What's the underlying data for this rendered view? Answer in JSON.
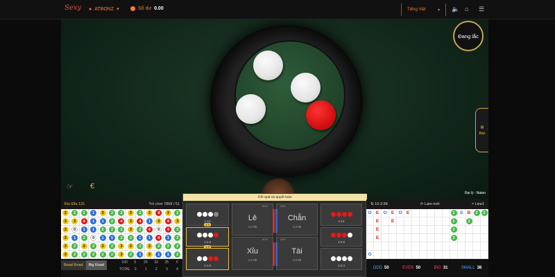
{
  "topbar": {
    "logo": "Sexy",
    "username": "ATBONZ",
    "balance_label": "Số dư",
    "balance_value": "0.00",
    "language": "Tiếng Việt"
  },
  "stage": {
    "shaking_label": "Đang lắc",
    "dealer_label": "Đại lý : Natan",
    "side_tab_label": "Bàn",
    "coins": [
      "white",
      "white",
      "white",
      "red"
    ]
  },
  "left_road": {
    "title": "Xóc Đĩa 131",
    "round_label": "Trò chơi 7858 / 51",
    "tab_bead": "Bead Road",
    "tab_big": "Big Road",
    "stats_header": [
      "100",
      "5",
      "25",
      "33",
      "25",
      "6"
    ],
    "stats_total_label": "TOTAL",
    "stats_total": [
      "0",
      "1",
      "2",
      "3",
      "4"
    ],
    "grid": [
      [
        "3",
        "2",
        "2",
        "1",
        "3",
        "2",
        "2",
        "3",
        "2",
        "3",
        "4",
        "3",
        "2"
      ],
      [
        "3",
        "3",
        "4",
        "1",
        "1",
        "2",
        "4",
        "3",
        "4",
        "1",
        "3",
        "4",
        "3"
      ],
      [
        "3",
        "0",
        "1",
        "1",
        "2",
        "2",
        "2",
        "3",
        "2",
        "4",
        "0",
        "4",
        "2"
      ],
      [
        "3",
        "1",
        "2",
        "0",
        "1",
        "1",
        "2",
        "2",
        "1",
        "1",
        "4",
        "1",
        "2"
      ],
      [
        "3",
        "2",
        "3",
        "2",
        "3",
        "2",
        "3",
        "3",
        "2",
        "3",
        "2",
        "2",
        "2"
      ],
      [
        "3",
        "2",
        "2",
        "2",
        "2",
        "2",
        "3",
        "2",
        "1",
        "3",
        "1",
        "1",
        "2"
      ]
    ]
  },
  "betting": {
    "header": "Kết quả và quyết toán",
    "cells": [
      {
        "label": "",
        "ratio": "1:12",
        "pattern": "wwwd"
      },
      {
        "label": "Lẻ",
        "ratio": "1:2.95",
        "pattern": ""
      },
      {
        "label": "Chẵn",
        "ratio": "1:2.95",
        "pattern": ""
      },
      {
        "label": "",
        "ratio": "1:12",
        "pattern": "rrrr"
      },
      {
        "label": "",
        "ratio": "1:2.6",
        "pattern": "wwwr"
      },
      {
        "label": "",
        "ratio": "1:2.6",
        "pattern": "rrrw"
      },
      {
        "label": "",
        "ratio": "1:1.5",
        "pattern": "wwrr"
      },
      {
        "label": "Xỉu",
        "ratio": "1:2.95",
        "pattern": ""
      },
      {
        "label": "Tài",
        "ratio": "1:2.95",
        "pattern": ""
      },
      {
        "label": "",
        "ratio": "1:2.4",
        "pattern": "wwww"
      }
    ],
    "tag_a": "1:1",
    "tag_b": "1:2",
    "pct_left_top": "50%",
    "pct_right_top": "50%",
    "pct_left_bot": "60%",
    "pct_right_bot": "40%"
  },
  "right_road": {
    "limit": "10-2.5K",
    "refresh": "Làm mới",
    "line": "Line1",
    "odd_label": "ODD",
    "odd_value": "50",
    "even_label": "EVEN",
    "even_value": "50",
    "big_label": "BIG",
    "big_value": "31",
    "small_label": "SMALL",
    "small_value": "38",
    "grid": [
      [
        "O",
        "E",
        "O",
        "E",
        "O",
        "E",
        "",
        "",
        "",
        "",
        "",
        "2",
        "S",
        "B",
        "2",
        "2"
      ],
      [
        "",
        "E",
        "",
        "E",
        "",
        "",
        "",
        "",
        "",
        "",
        "",
        "2",
        "",
        "2",
        "",
        ""
      ],
      [
        "",
        "E",
        "",
        "",
        "",
        "",
        "",
        "",
        "",
        "",
        "",
        "2",
        "",
        "",
        "",
        ""
      ],
      [
        "",
        "E",
        "",
        "",
        "",
        "",
        "",
        "",
        "",
        "",
        "",
        "2",
        "",
        "",
        "",
        ""
      ],
      [
        "",
        "",
        "",
        "",
        "",
        "",
        "",
        "",
        "",
        "",
        "",
        "",
        "",
        "",
        "",
        ""
      ],
      [
        "O",
        "",
        "",
        "",
        "",
        "",
        "",
        "",
        "",
        "",
        "",
        "",
        "",
        "",
        "",
        ""
      ]
    ]
  }
}
